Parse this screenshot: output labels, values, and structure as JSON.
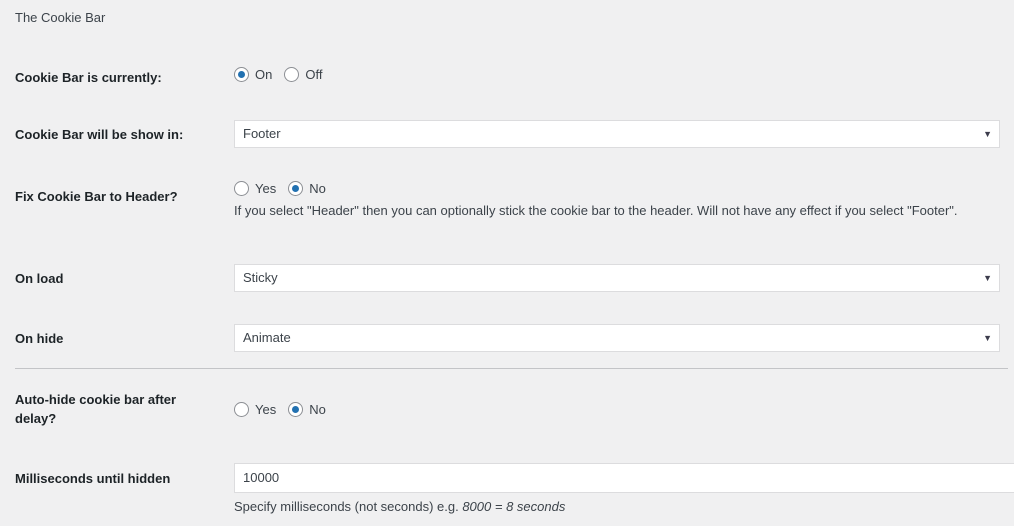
{
  "section": {
    "heading": "The Cookie Bar"
  },
  "fields": [
    {
      "label": "Cookie Bar is currently:",
      "type": "radio",
      "options": [
        {
          "label": "On",
          "checked": true
        },
        {
          "label": "Off",
          "checked": false
        }
      ]
    },
    {
      "label": "Cookie Bar will be show in:",
      "type": "select",
      "value": "Footer",
      "arrow": "chevron-down-icon"
    },
    {
      "label": "Fix Cookie Bar to Header?",
      "type": "radio",
      "options": [
        {
          "label": "Yes",
          "checked": false
        },
        {
          "label": "No",
          "checked": true
        }
      ],
      "description": "If you select \"Header\" then you can optionally stick the cookie bar to the header. Will not have any effect if you select \"Footer\"."
    },
    {
      "label": "On load",
      "type": "select",
      "value": "Sticky",
      "arrow": "chevron-down-icon"
    },
    {
      "label": "On hide",
      "type": "select",
      "value": "Animate",
      "arrow": "chevron-down-icon"
    },
    {
      "label": "Auto-hide cookie bar after delay?",
      "type": "radio",
      "options": [
        {
          "label": "Yes",
          "checked": false
        },
        {
          "label": "No",
          "checked": true
        }
      ]
    },
    {
      "label": "Milliseconds until hidden",
      "type": "text",
      "value": "10000",
      "description_prefix": "Specify milliseconds (not seconds) e.g. ",
      "description_italic": "8000 = 8 seconds"
    }
  ],
  "colors": {
    "background": "#f0f0f1",
    "accent": "#2271b1",
    "label_text": "#1d2327",
    "body_text": "#3c434a",
    "border": "#dcdcde",
    "divider": "#c3c4c7"
  }
}
